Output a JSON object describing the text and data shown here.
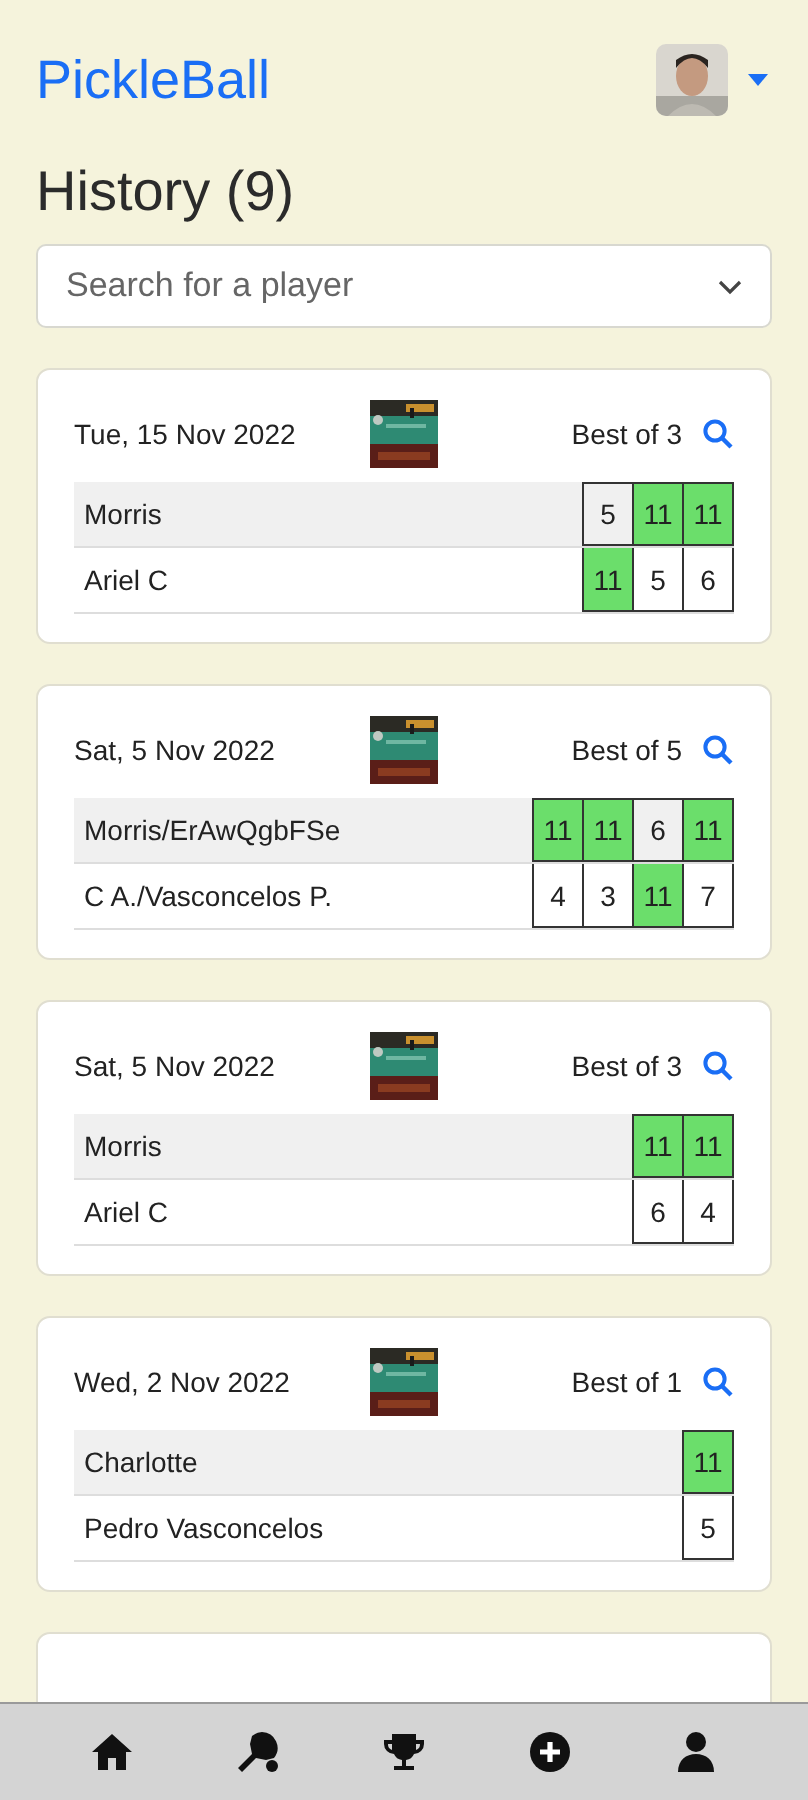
{
  "header": {
    "brand": "PickleBall"
  },
  "title": "History (9)",
  "search": {
    "placeholder": "Search for a player"
  },
  "matches": [
    {
      "date": "Tue, 15 Nov 2022",
      "format": "Best of 3",
      "teams": [
        {
          "name": "Morris",
          "scores": [
            {
              "value": "5",
              "won": false
            },
            {
              "value": "11",
              "won": true
            },
            {
              "value": "11",
              "won": true
            }
          ]
        },
        {
          "name": "Ariel C",
          "scores": [
            {
              "value": "11",
              "won": true
            },
            {
              "value": "5",
              "won": false
            },
            {
              "value": "6",
              "won": false
            }
          ]
        }
      ]
    },
    {
      "date": "Sat, 5 Nov 2022",
      "format": "Best of 5",
      "teams": [
        {
          "name": "Morris/ErAwQgbFSe",
          "scores": [
            {
              "value": "11",
              "won": true
            },
            {
              "value": "11",
              "won": true
            },
            {
              "value": "6",
              "won": false
            },
            {
              "value": "11",
              "won": true
            }
          ]
        },
        {
          "name": "C A./Vasconcelos P.",
          "scores": [
            {
              "value": "4",
              "won": false
            },
            {
              "value": "3",
              "won": false
            },
            {
              "value": "11",
              "won": true
            },
            {
              "value": "7",
              "won": false
            }
          ]
        }
      ]
    },
    {
      "date": "Sat, 5 Nov 2022",
      "format": "Best of 3",
      "teams": [
        {
          "name": "Morris",
          "scores": [
            {
              "value": "11",
              "won": true
            },
            {
              "value": "11",
              "won": true
            }
          ]
        },
        {
          "name": "Ariel C",
          "scores": [
            {
              "value": "6",
              "won": false
            },
            {
              "value": "4",
              "won": false
            }
          ]
        }
      ]
    },
    {
      "date": "Wed, 2 Nov 2022",
      "format": "Best of 1",
      "teams": [
        {
          "name": "Charlotte",
          "scores": [
            {
              "value": "11",
              "won": true
            }
          ]
        },
        {
          "name": "Pedro Vasconcelos",
          "scores": [
            {
              "value": "5",
              "won": false
            }
          ]
        }
      ]
    }
  ],
  "more_below": true,
  "nav": [
    {
      "kind": "home"
    },
    {
      "kind": "paddle"
    },
    {
      "kind": "trophy"
    },
    {
      "kind": "add"
    },
    {
      "kind": "profile"
    }
  ]
}
